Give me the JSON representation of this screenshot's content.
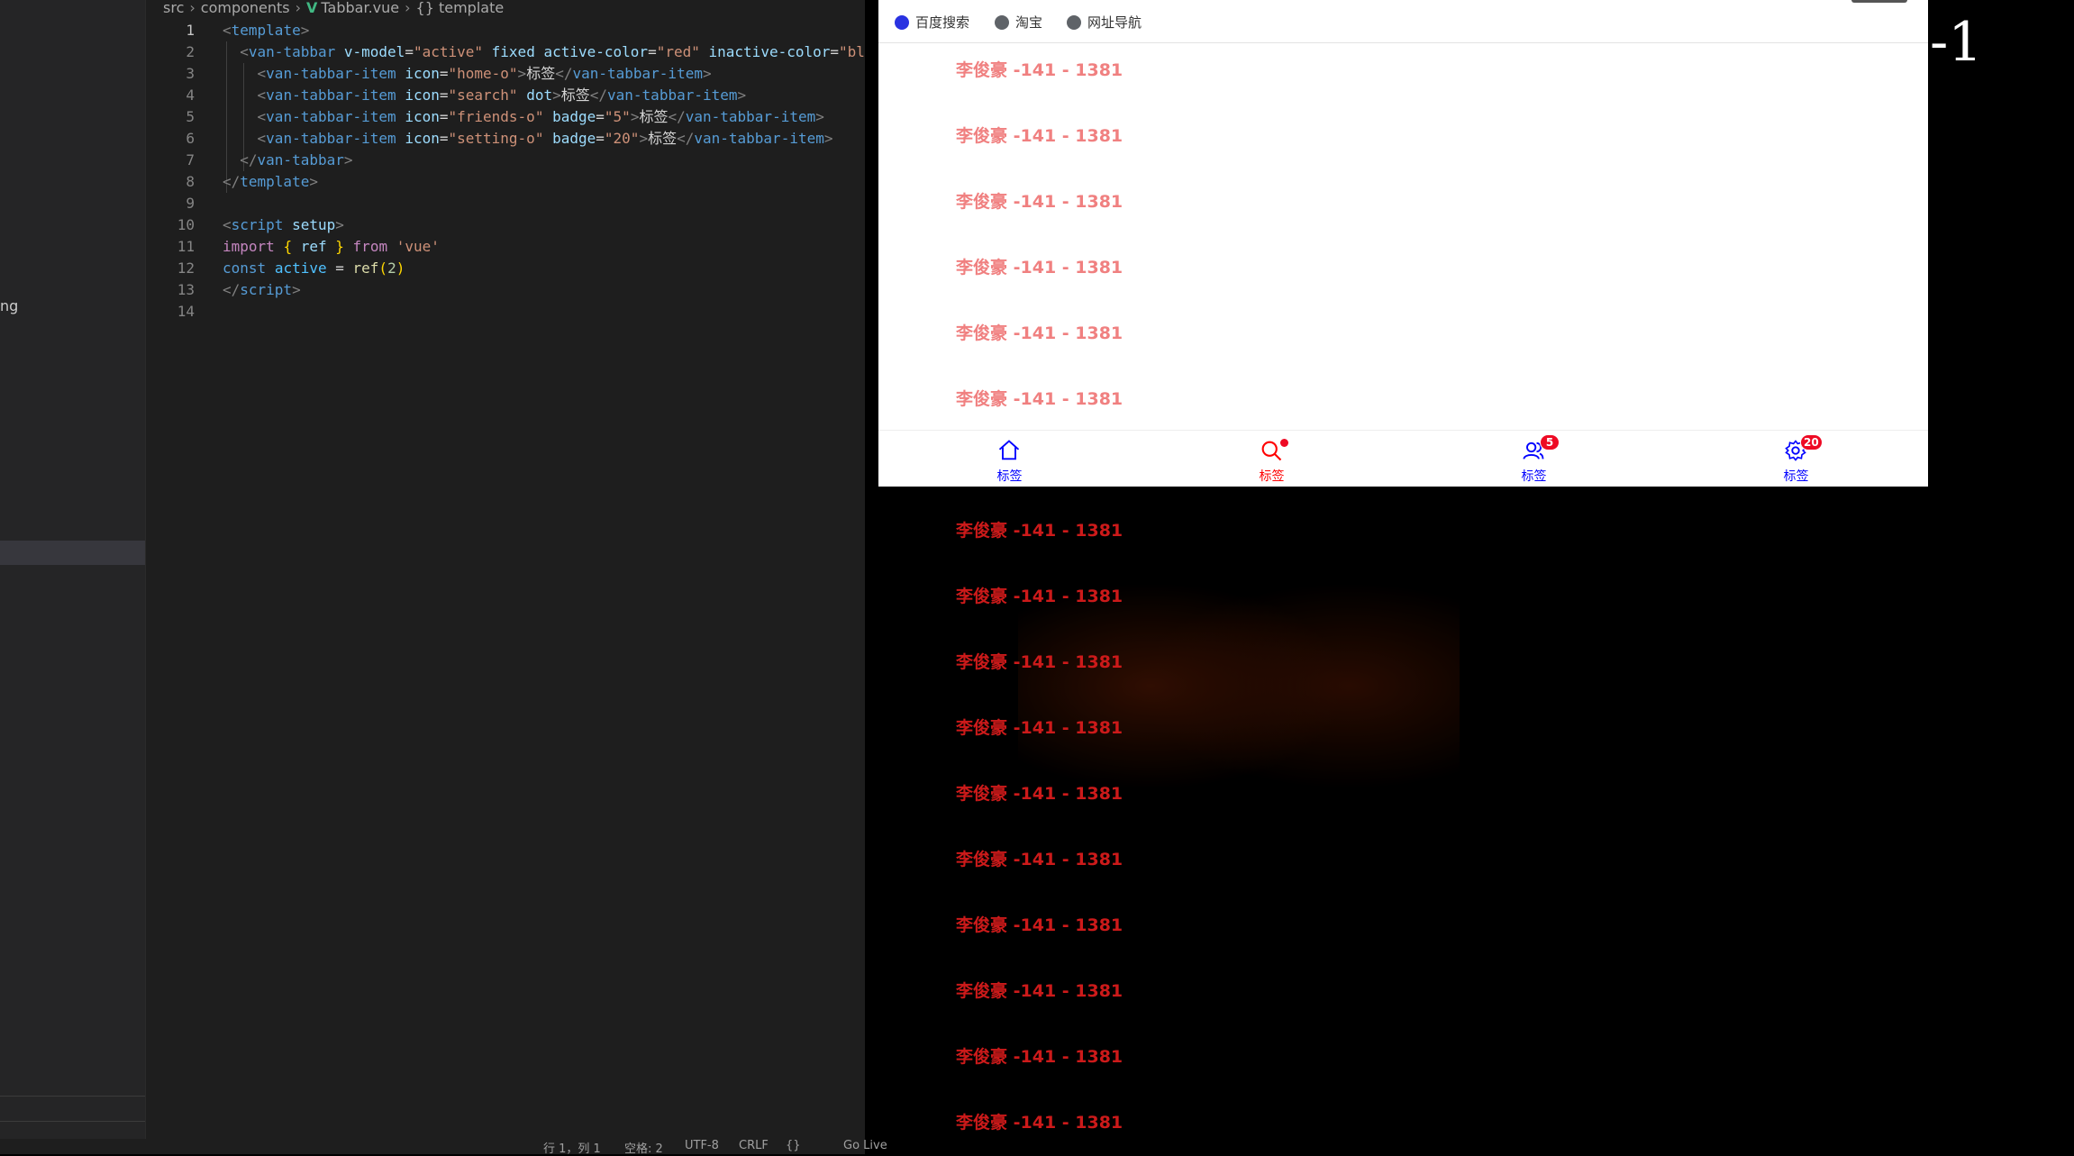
{
  "breadcrumb": [
    "src",
    "components",
    "Tabbar.vue",
    "{} template"
  ],
  "sidebar_fragment": "ng",
  "code_lines": [
    {
      "n": "1"
    },
    {
      "n": "2"
    },
    {
      "n": "3"
    },
    {
      "n": "4"
    },
    {
      "n": "5"
    },
    {
      "n": "6"
    },
    {
      "n": "7"
    },
    {
      "n": "8"
    },
    {
      "n": "9"
    },
    {
      "n": "10"
    },
    {
      "n": "11"
    },
    {
      "n": "12"
    },
    {
      "n": "13"
    },
    {
      "n": "14"
    }
  ],
  "code": {
    "l1_tag": "template",
    "l2_tag": "van-tabbar",
    "l2_a1": "v-model",
    "l2_v1": "\"active\"",
    "l2_a2": "fixed",
    "l2_a3": "active-color",
    "l2_v3": "\"red\"",
    "l2_a4": "inactive-color",
    "l2_v4": "\"bl",
    "item_tag": "van-tabbar-item",
    "icon_attr": "icon",
    "badge_attr": "badge",
    "dot_attr": "dot",
    "l3_icon": "\"home-o\"",
    "l4_icon": "\"search\"",
    "l5_icon": "\"friends-o\"",
    "l5_badge": "\"5\"",
    "l6_icon": "\"setting-o\"",
    "l6_badge": "\"20\"",
    "item_text": "标签",
    "l7_tag": "van-tabbar",
    "l8_tag": "template",
    "l10_tag": "script",
    "l10_attr": "setup",
    "l11_import": "import",
    "l11_ref": "ref",
    "l11_from": "from",
    "l11_mod": "'vue'",
    "l12_const": "const",
    "l12_var": "active",
    "l12_fn": "ref",
    "l12_num": "2"
  },
  "status": {
    "pos": "行 1，列 1",
    "spaces": "空格: 2",
    "encoding": "UTF-8",
    "eol": "CRLF",
    "lang": "{}",
    "extra": "Go Live"
  },
  "bookmarks": [
    {
      "label": "百度搜索",
      "icon": "baidu-paw-icon"
    },
    {
      "label": "淘宝",
      "icon": "globe-icon"
    },
    {
      "label": "网址导航",
      "icon": "globe-icon"
    }
  ],
  "repeated_text": "李俊豪 -141 - 1381",
  "repeated_count": 18,
  "tabs": [
    {
      "label": "标签",
      "icon": "home-o",
      "active": false
    },
    {
      "label": "标签",
      "icon": "search",
      "active": true,
      "dot": true
    },
    {
      "label": "标签",
      "icon": "friends-o",
      "active": false,
      "badge": "5"
    },
    {
      "label": "标签",
      "icon": "setting-o",
      "active": false,
      "badge": "20"
    }
  ],
  "edge_glyph": "-1",
  "colors": {
    "active_tab": "#ff0000",
    "inactive_tab": "#0000ff",
    "text_on_white": "#f08080",
    "text_on_dark": "#cc1a1a",
    "badge": "#ee0a24"
  }
}
